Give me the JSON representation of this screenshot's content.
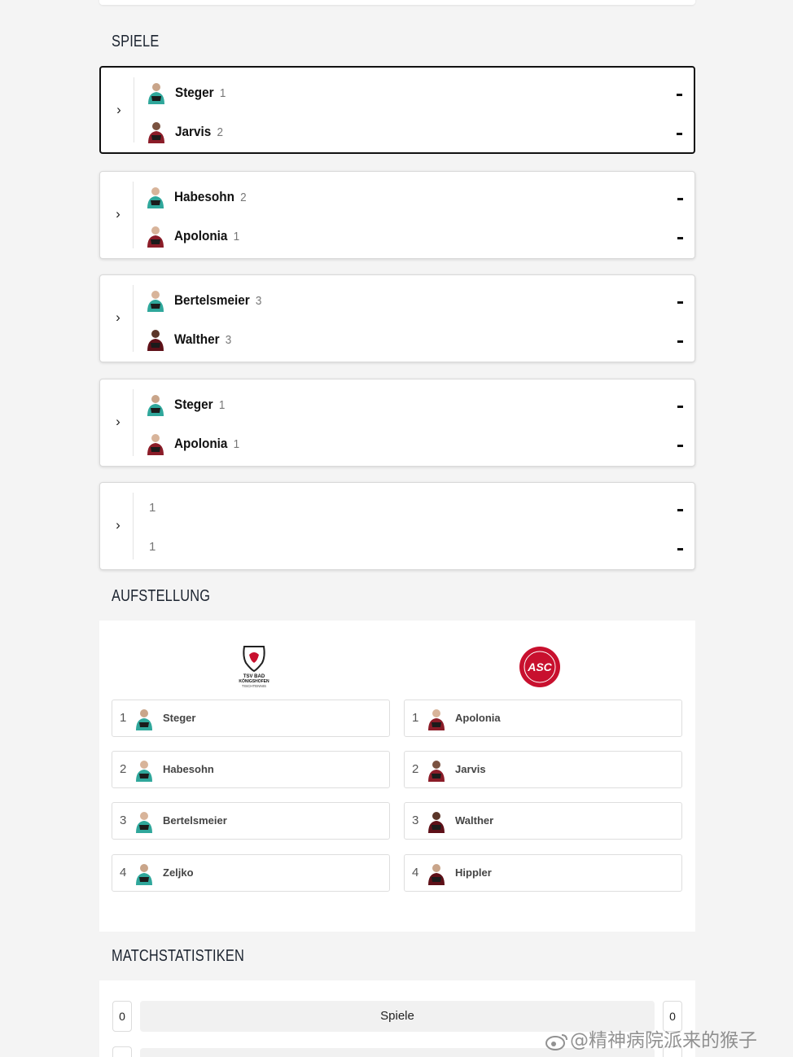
{
  "sections": {
    "spiele": "SPIELE",
    "aufstellung": "AUFSTELLUNG",
    "matchstatistiken": "MATCHSTATISTIKEN"
  },
  "colors": {
    "home": "#2fa79b",
    "away": "#8b1c28",
    "active_border": "#111111"
  },
  "matches": [
    {
      "home": {
        "name": "Steger",
        "seed": "1"
      },
      "away": {
        "name": "Jarvis",
        "seed": "2"
      },
      "home_score": "-",
      "away_score": "-",
      "active": true
    },
    {
      "home": {
        "name": "Habesohn",
        "seed": "2"
      },
      "away": {
        "name": "Apolonia",
        "seed": "1"
      },
      "home_score": "-",
      "away_score": "-"
    },
    {
      "home": {
        "name": "Bertelsmeier",
        "seed": "3"
      },
      "away": {
        "name": "Walther",
        "seed": "3"
      },
      "home_score": "-",
      "away_score": "-"
    },
    {
      "home": {
        "name": "Steger",
        "seed": "1"
      },
      "away": {
        "name": "Apolonia",
        "seed": "1"
      },
      "home_score": "-",
      "away_score": "-"
    },
    {
      "home": {
        "name": "",
        "seed": "1"
      },
      "away": {
        "name": "",
        "seed": "1"
      },
      "home_score": "-",
      "away_score": "-"
    }
  ],
  "lineup": {
    "home_logo_text": [
      "TSV BAD",
      "KÖNIGSHOFEN",
      "TISCHTENNIS"
    ],
    "away_logo_text": "ASC",
    "home": [
      {
        "num": "1",
        "name": "Steger"
      },
      {
        "num": "2",
        "name": "Habesohn"
      },
      {
        "num": "3",
        "name": "Bertelsmeier"
      },
      {
        "num": "4",
        "name": "Zeljko"
      }
    ],
    "away": [
      {
        "num": "1",
        "name": "Apolonia"
      },
      {
        "num": "2",
        "name": "Jarvis"
      },
      {
        "num": "3",
        "name": "Walther"
      },
      {
        "num": "4",
        "name": "Hippler"
      }
    ]
  },
  "stats": [
    {
      "home": "0",
      "label": "Spiele",
      "away": "0"
    }
  ],
  "watermark": "@精神病院派来的猴子"
}
